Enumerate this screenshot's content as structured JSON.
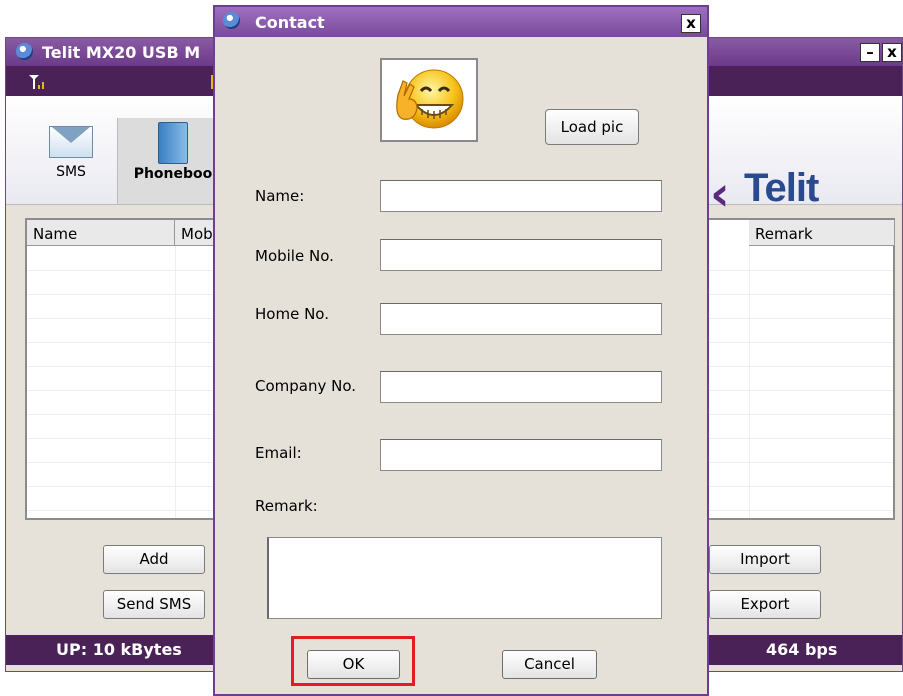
{
  "app": {
    "title": "Telit MX20 USB M",
    "toolbar": {
      "sms_label": "SMS",
      "phonebook_label": "Phoneboo"
    },
    "logo_text": "Telit",
    "table": {
      "col_name": "Name",
      "col_mobile": "Mob",
      "col_remark": "Remark"
    },
    "buttons": {
      "add": "Add",
      "send_sms": "Send SMS",
      "import": "Import",
      "export": "Export"
    },
    "status": {
      "upload": "UP: 10 kBytes",
      "rate": "464 bps"
    },
    "win": {
      "minimize": "–",
      "close": "x"
    }
  },
  "dialog": {
    "title": "Contact",
    "close": "x",
    "load_pic": "Load pic",
    "fields": {
      "name_label": "Name:",
      "mobile_label": "Mobile No.",
      "home_label": "Home No.",
      "company_label": "Company No.",
      "email_label": "Email:",
      "remark_label": "Remark:"
    },
    "ok": "OK",
    "cancel": "Cancel"
  },
  "colors": {
    "title_purple": "#6b3a89",
    "bar_purple": "#4a2258",
    "highlight_red": "#e31b23"
  }
}
